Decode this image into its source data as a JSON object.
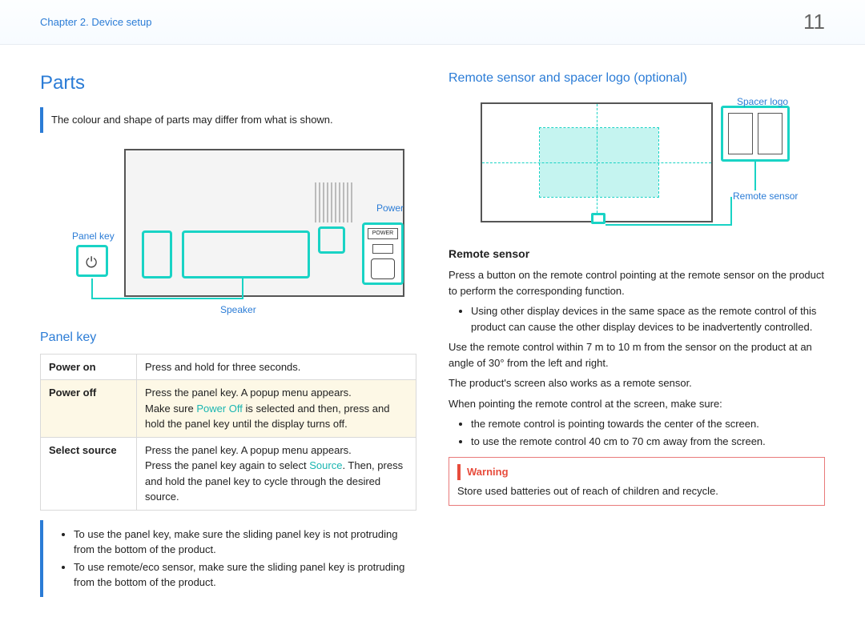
{
  "header": {
    "chapter": "Chapter 2. Device setup",
    "page_number": "11"
  },
  "left": {
    "title": "Parts",
    "intro_note": "The colour and shape of parts may differ from what is shown.",
    "diagram_labels": {
      "panel_key": "Panel key",
      "speaker": "Speaker",
      "power": "Power"
    },
    "panel_key_heading": "Panel key",
    "table": {
      "rows": [
        {
          "k": "Power on",
          "v": "Press and hold for three seconds."
        },
        {
          "k": "Power off",
          "v1": "Press the panel key. A popup menu appears.",
          "v2a": "Make sure ",
          "v2kw": "Power Off",
          "v2b": " is selected and then, press and hold the panel key until the display turns off."
        },
        {
          "k": "Select source",
          "v1": "Press the panel key. A popup menu appears.",
          "v2a": "Press the panel key again to select ",
          "v2kw": "Source",
          "v2b": ". Then, press and hold the panel key to cycle through the desired source."
        }
      ]
    },
    "bottom_note": {
      "b1": "To use the panel key, make sure the sliding panel key is not protruding from the bottom of the product.",
      "b2": "To use remote/eco sensor, make sure the sliding panel key is protruding from the bottom of the product."
    }
  },
  "right": {
    "heading": "Remote sensor and spacer logo (optional)",
    "diagram_labels": {
      "spacer_logo": "Spacer logo",
      "remote_sensor": "Remote sensor"
    },
    "remote_sensor_heading": "Remote sensor",
    "p1": "Press a button on the remote control pointing at the remote sensor on the product to perform the corresponding function.",
    "bullet1": "Using other display devices in the same space as the remote control of this product can cause the other display devices to be inadvertently controlled.",
    "p2": "Use the remote control within 7 m to 10 m from the sensor on the product at an angle of 30° from the left and right.",
    "p3": "The product's screen also works as a remote sensor.",
    "p4": "When pointing the remote control at the screen, make sure:",
    "bullet2": "the remote control is pointing towards the center of the screen.",
    "bullet3": "to use the remote control 40 cm to 70 cm away from the screen.",
    "warning_title": "Warning",
    "warning_text": "Store used batteries out of reach of children and recycle."
  }
}
